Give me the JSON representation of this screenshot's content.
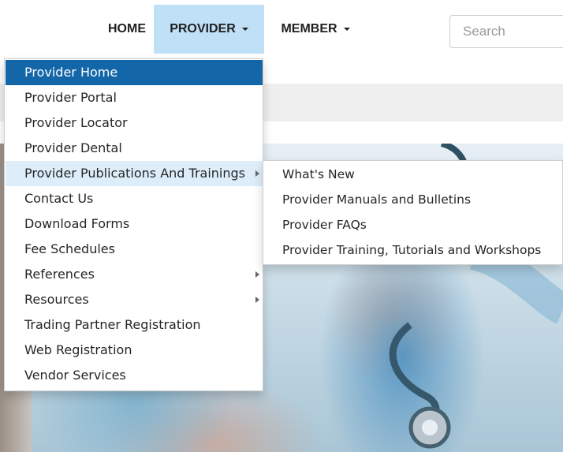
{
  "nav": {
    "home": "HOME",
    "provider": "PROVIDER",
    "member": "MEMBER",
    "search_placeholder": "Search"
  },
  "provider_menu": {
    "items": [
      {
        "label": "Provider Home",
        "state": "active"
      },
      {
        "label": "Provider Portal"
      },
      {
        "label": "Provider Locator"
      },
      {
        "label": "Provider Dental"
      },
      {
        "label": "Provider Publications And Trainings",
        "state": "hover",
        "has_submenu": true
      },
      {
        "label": "Contact Us"
      },
      {
        "label": "Download Forms"
      },
      {
        "label": "Fee Schedules"
      },
      {
        "label": "References",
        "has_submenu": true
      },
      {
        "label": "Resources",
        "has_submenu": true
      },
      {
        "label": "Trading Partner Registration"
      },
      {
        "label": "Web Registration"
      },
      {
        "label": "Vendor Services"
      }
    ]
  },
  "publications_submenu": {
    "items": [
      {
        "label": "What's New"
      },
      {
        "label": "Provider Manuals and Bulletins"
      },
      {
        "label": "Provider FAQs"
      },
      {
        "label": "Provider Training, Tutorials and Workshops"
      }
    ]
  },
  "colors": {
    "active_bg": "#1366a8",
    "hover_bg": "#ddeefa",
    "nav_open_bg": "#bfe0f7"
  },
  "hero": {
    "image": "healthcare-worker-with-stethoscope"
  }
}
